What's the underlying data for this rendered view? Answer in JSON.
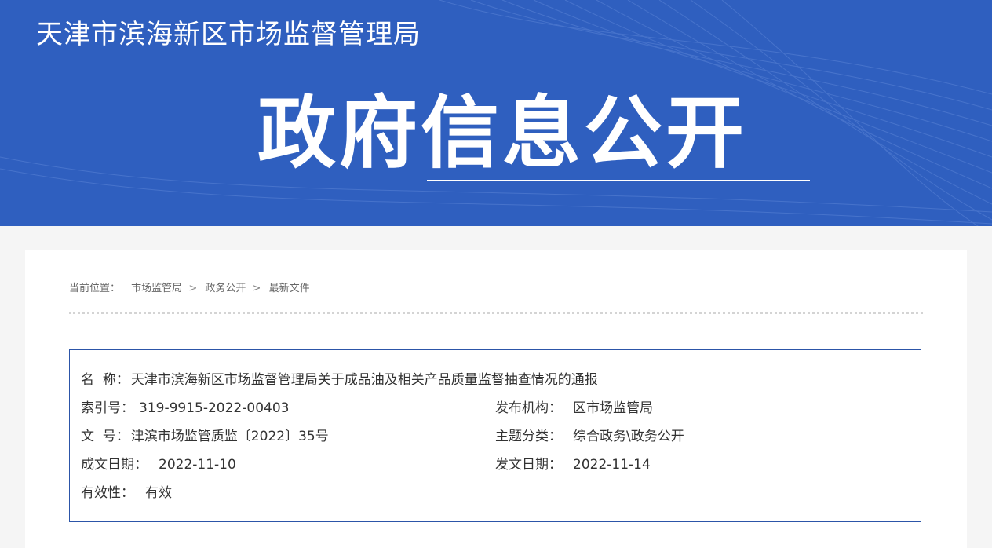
{
  "header": {
    "site_name": "天津市滨海新区市场监督管理局",
    "banner_title": "政府信息公开"
  },
  "breadcrumb": {
    "label": "当前位置：",
    "items": [
      "市场监管局",
      "政务公开",
      "最新文件"
    ],
    "separator": ">"
  },
  "document_info": {
    "name_label": "名  称：",
    "name_value": "天津市滨海新区市场监督管理局关于成品油及相关产品质量监督抽查情况的通报",
    "index_label": "索引号：",
    "index_value": "319-9915-2022-00403",
    "publisher_label": "发布机构：",
    "publisher_value": "区市场监管局",
    "doc_no_label": "文  号：",
    "doc_no_value": "津滨市场监管质监〔2022〕35号",
    "topic_label": "主题分类：",
    "topic_value": "综合政务\\政务公开",
    "created_label": "成文日期：",
    "created_value": "2022-11-10",
    "published_label": "发文日期：",
    "published_value": "2022-11-14",
    "validity_label": "有效性：",
    "validity_value": "有效"
  },
  "colors": {
    "banner_blue": "#2f5fbf",
    "box_border": "#2c55a8"
  }
}
